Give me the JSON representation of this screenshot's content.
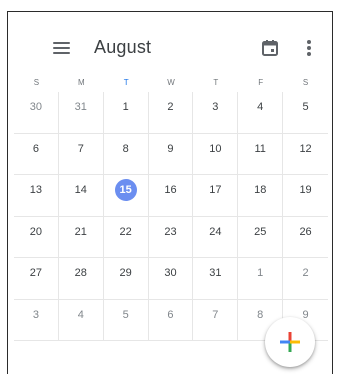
{
  "header": {
    "title": "August",
    "menu_icon": "hamburger-menu-icon",
    "today_icon": "calendar-today-icon",
    "more_icon": "more-vert-icon"
  },
  "weekdays": [
    "S",
    "M",
    "T",
    "W",
    "T",
    "F",
    "S"
  ],
  "today_weekday_index": 2,
  "weeks": [
    [
      {
        "day": "30",
        "other_month": true
      },
      {
        "day": "31",
        "other_month": true
      },
      {
        "day": "1"
      },
      {
        "day": "2"
      },
      {
        "day": "3"
      },
      {
        "day": "4"
      },
      {
        "day": "5"
      }
    ],
    [
      {
        "day": "6"
      },
      {
        "day": "7"
      },
      {
        "day": "8"
      },
      {
        "day": "9"
      },
      {
        "day": "10"
      },
      {
        "day": "11"
      },
      {
        "day": "12"
      }
    ],
    [
      {
        "day": "13"
      },
      {
        "day": "14"
      },
      {
        "day": "15",
        "today": true
      },
      {
        "day": "16"
      },
      {
        "day": "17"
      },
      {
        "day": "18"
      },
      {
        "day": "19"
      }
    ],
    [
      {
        "day": "20"
      },
      {
        "day": "21"
      },
      {
        "day": "22"
      },
      {
        "day": "23"
      },
      {
        "day": "24"
      },
      {
        "day": "25"
      },
      {
        "day": "26"
      }
    ],
    [
      {
        "day": "27"
      },
      {
        "day": "28"
      },
      {
        "day": "29"
      },
      {
        "day": "30"
      },
      {
        "day": "31"
      },
      {
        "day": "1",
        "other_month": true
      },
      {
        "day": "2",
        "other_month": true
      }
    ],
    [
      {
        "day": "3",
        "other_month": true
      },
      {
        "day": "4",
        "other_month": true
      },
      {
        "day": "5",
        "other_month": true
      },
      {
        "day": "6",
        "other_month": true
      },
      {
        "day": "7",
        "other_month": true
      },
      {
        "day": "8",
        "other_month": true
      },
      {
        "day": "9",
        "other_month": true
      }
    ]
  ],
  "fab": {
    "icon": "add-plus-icon"
  },
  "colors": {
    "accent": "#1a73e8",
    "today_highlight": "#6b8ef0",
    "plus_blue": "#4285f4",
    "plus_red": "#ea4335",
    "plus_yellow": "#fbbc04",
    "plus_green": "#34a853"
  }
}
